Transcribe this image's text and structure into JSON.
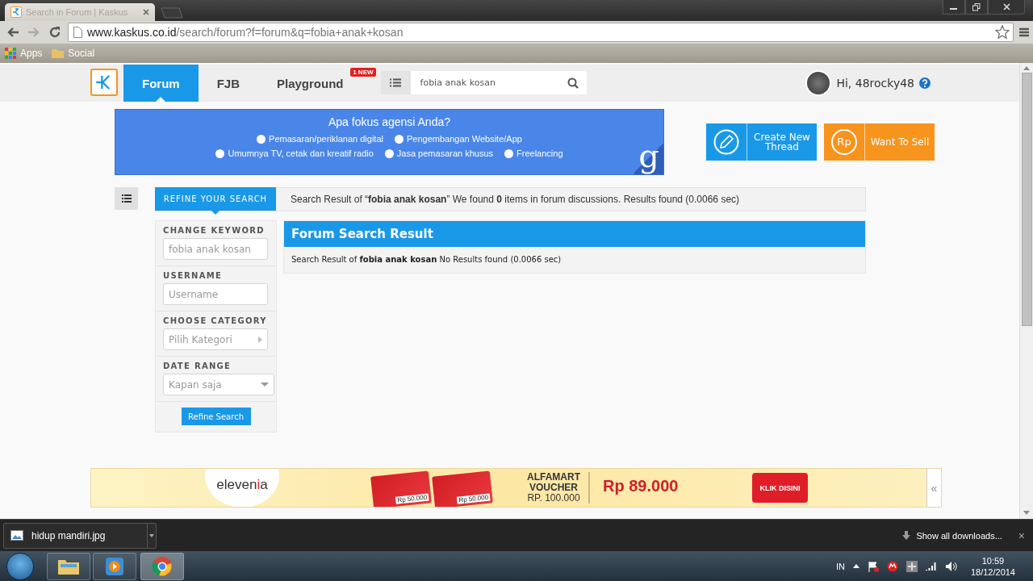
{
  "browser": {
    "tab_title": "Search in Forum | Kaskus",
    "url_host": "www.kaskus.co.id",
    "url_path": "/search/forum?f=forum&q=fobia+anak+kosan",
    "bookmarks": [
      {
        "label": "Apps",
        "kind": "apps"
      },
      {
        "label": "Social",
        "kind": "folder"
      }
    ]
  },
  "header": {
    "tabs": [
      {
        "label": "Forum",
        "selected": true
      },
      {
        "label": "FJB",
        "selected": false
      },
      {
        "label": "Playground",
        "selected": false,
        "badge": "1 NEW"
      }
    ],
    "search": {
      "value": "fobia anak kosan"
    },
    "greeting": "Hi, 48rocky48"
  },
  "ad_banner": {
    "title": "Apa fokus agensi Anda?",
    "logo_letter": "g",
    "option_rows": [
      [
        {
          "label": "Pemasaran/periklanan digital",
          "selected": false
        },
        {
          "label": "Pengembangan Website/App",
          "selected": false
        }
      ],
      [
        {
          "label": "Umumnya TV, cetak dan kreatif radio",
          "selected": false
        },
        {
          "label": "Jasa pemasaran khusus",
          "selected": false
        },
        {
          "label": "Freelancing",
          "selected": false
        }
      ]
    ]
  },
  "actions": [
    {
      "kind": "thread",
      "label": "Create New Thread"
    },
    {
      "kind": "sell",
      "label": "Want To Sell",
      "icon_text": "Rp"
    }
  ],
  "refine_tab": "REFINE YOUR SEARCH",
  "summary": "Search Result of “**fobia anak kosan**” We found **0** items in forum discussions. Results found (0.0066 sec)",
  "filters": [
    {
      "label": "CHANGE KEYWORD",
      "kind": "text",
      "placeholder": "fobia anak kosan"
    },
    {
      "label": "USERNAME",
      "kind": "text",
      "placeholder": "Username"
    },
    {
      "label": "CHOOSE CATEGORY",
      "kind": "picker",
      "placeholder": "Pilih Kategori"
    },
    {
      "label": "DATE RANGE",
      "kind": "dropdown",
      "placeholder": "Kapan saja"
    }
  ],
  "refine_button": "Refine Search",
  "result": {
    "title": "Forum Search Result",
    "message": "Search Result of **fobia anak kosan** No Results found (0.0066 sec)"
  },
  "bottom_ad": {
    "brand_start": "eleven",
    "brand_mark": "i",
    "brand_end": "a",
    "card_prices": [
      "Rp 50.000",
      "Rp 50.000"
    ],
    "voucher_lines": [
      "ALFAMART",
      "VOUCHER"
    ],
    "voucher_value": "RP. 100.000",
    "price": "Rp 89.000",
    "cta": "KLIK DISINI",
    "collapse": "«"
  },
  "downloads": {
    "file": "hidup mandiri.jpg",
    "show_all": "Show all downloads...",
    "close": "×"
  },
  "taskbar": {
    "language": "IN",
    "time": "10:59",
    "date": "18/12/2014"
  }
}
